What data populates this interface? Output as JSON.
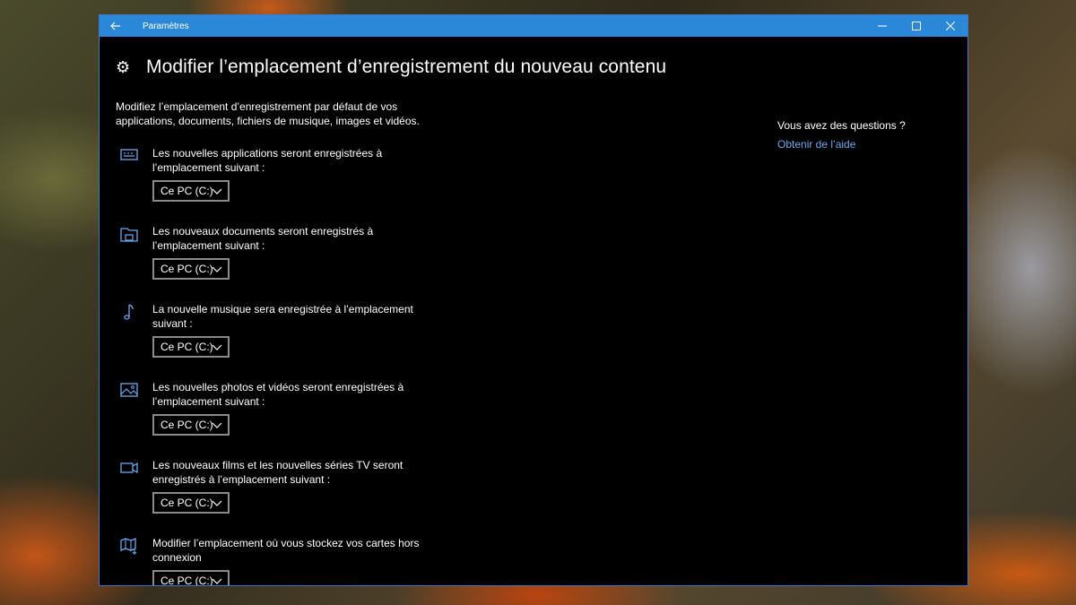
{
  "window": {
    "title": "Paramètres",
    "back_icon": "back-arrow-icon",
    "controls": [
      "minimize-icon",
      "maximize-icon",
      "close-icon"
    ]
  },
  "page": {
    "title": "Modifier l’emplacement d’enregistrement du nouveau contenu",
    "description": "Modifiez l’emplacement d’enregistrement par défaut de vos applications, documents, fichiers de musique, images et vidéos."
  },
  "settings": [
    {
      "icon": "app-icon",
      "label": "Les nouvelles applications seront enregistrées à l’emplacement suivant :",
      "value": "Ce PC (C:)"
    },
    {
      "icon": "documents-icon",
      "label": "Les nouveaux documents seront enregistrés à l’emplacement suivant :",
      "value": "Ce PC (C:)"
    },
    {
      "icon": "music-icon",
      "label": "La nouvelle musique sera enregistrée à l’emplacement suivant :",
      "value": "Ce PC (C:)"
    },
    {
      "icon": "photo-icon",
      "label": "Les nouvelles photos et vidéos seront enregistrées à l’emplacement suivant :",
      "value": "Ce PC (C:)"
    },
    {
      "icon": "video-icon",
      "label": "Les nouveaux films et les nouvelles séries TV seront enregistrés à l’emplacement suivant :",
      "value": "Ce PC (C:)"
    },
    {
      "icon": "map-icon",
      "label": "Modifier l’emplacement où vous stockez vos cartes hors connexion",
      "value": "Ce PC (C:)"
    }
  ],
  "help": {
    "question": "Vous avez des questions ?",
    "link": "Obtenir de l’aide"
  },
  "colors": {
    "titlebar": "#2b88d8",
    "accent": "#6aa9ec",
    "background": "#000000"
  }
}
